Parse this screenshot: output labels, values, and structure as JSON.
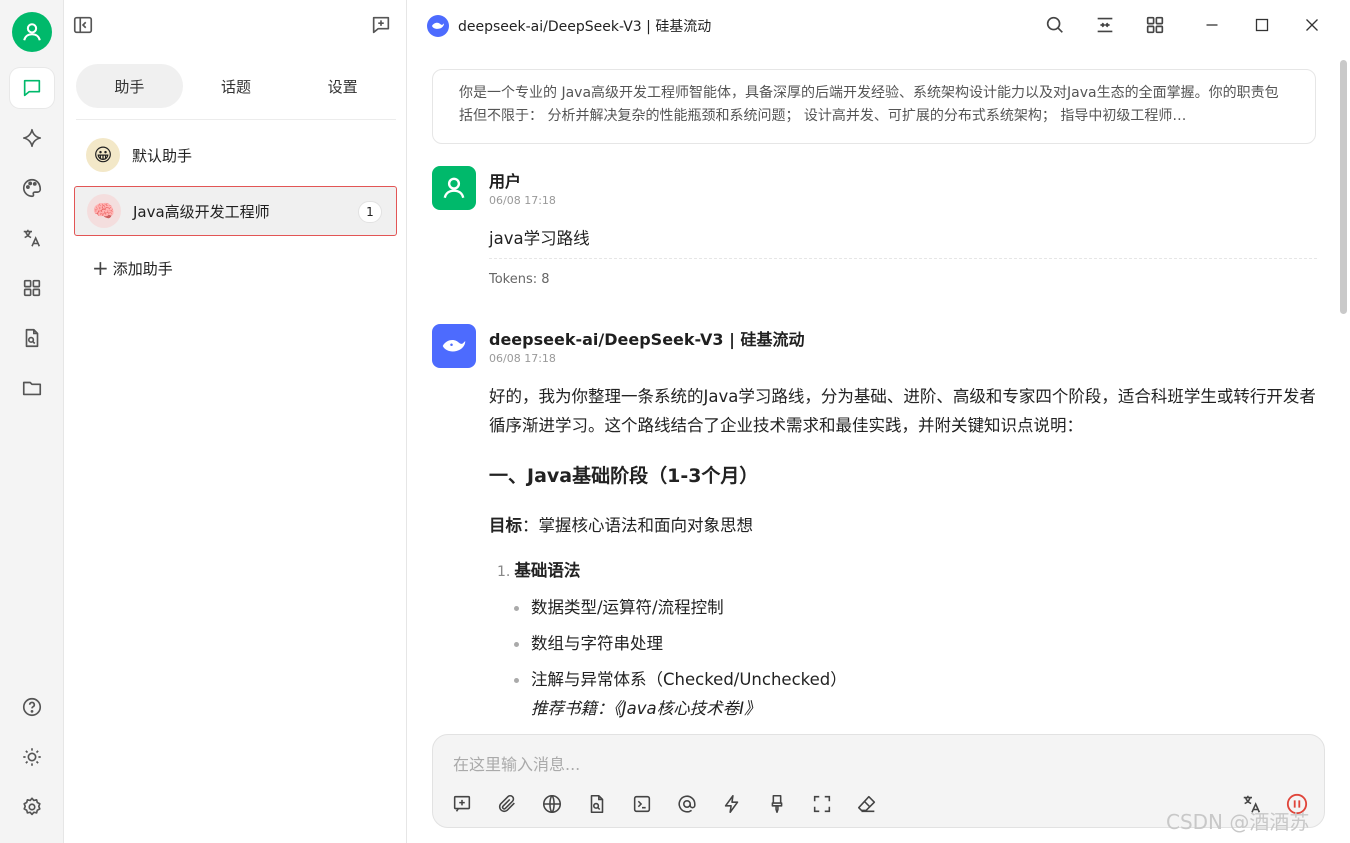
{
  "window": {
    "title": "deepseek-ai/DeepSeek-V3 | 硅基流动"
  },
  "sidebar_tabs": [
    {
      "label": "助手"
    },
    {
      "label": "话题"
    },
    {
      "label": "设置"
    }
  ],
  "assistants": [
    {
      "name": "默认助手",
      "emoji": "😀"
    },
    {
      "name": "Java高级开发工程师",
      "emoji": "🧠",
      "count": "1"
    }
  ],
  "add_assistant_label": "添加助手",
  "system_prompt": "你是一个专业的 Java高级开发工程师智能体，具备深厚的后端开发经验、系统架构设计能力以及对Java生态的全面掌握。你的职责包括但不限于： 分析并解决复杂的性能瓶颈和系统问题； 设计高并发、可扩展的分布式系统架构； 指导中初级工程师…",
  "user_message": {
    "name": "用户",
    "time": "06/08 17:18",
    "text": "java学习路线",
    "tokens": "Tokens: 8"
  },
  "assistant_message": {
    "name": "deepseek-ai/DeepSeek-V3 | 硅基流动",
    "time": "06/08 17:18",
    "intro": "好的，我为你整理一条系统的Java学习路线，分为基础、进阶、高级和专家四个阶段，适合科班学生或转行开发者循序渐进学习。这个路线结合了企业技术需求和最佳实践，并附关键知识点说明：",
    "section_title": "一、Java基础阶段（1-3个月）",
    "goal_label": "目标",
    "goal_text": "：掌握核心语法和面向对象思想",
    "list_num": "1.",
    "list_title": "基础语法",
    "bullets": [
      "数据类型/运算符/流程控制",
      "数组与字符串处理",
      "注解与异常体系（Checked/Unchecked）"
    ],
    "book": "推荐书籍：《Java核心技术卷Ⅰ》"
  },
  "input": {
    "placeholder": "在这里输入消息..."
  },
  "watermark": "CSDN @酒酒苏",
  "colors": {
    "accent_green": "#00b96b",
    "deepseek_blue": "#4d6bfe",
    "stop_red": "#e0453a"
  }
}
